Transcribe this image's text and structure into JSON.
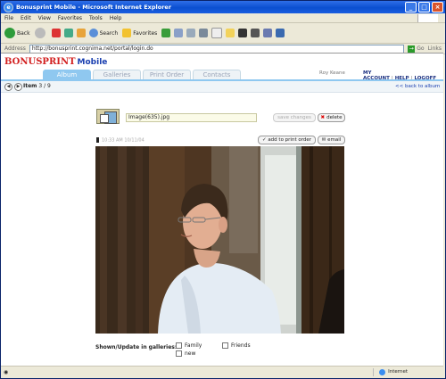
{
  "window": {
    "title": "Bonusprint Mobile - Microsoft Internet Explorer"
  },
  "menu": [
    "File",
    "Edit",
    "View",
    "Favorites",
    "Tools",
    "Help"
  ],
  "toolbar": {
    "back_label": "Back",
    "search_label": "Search",
    "favorites_label": "Favorites"
  },
  "address": {
    "label": "Address",
    "url": "http://bonusprint.cognima.net/portal/login.do",
    "go_label": "Go",
    "links_label": "Links"
  },
  "brand": {
    "name": "BONUSPRINT",
    "suffix": "Mobile"
  },
  "tabs": [
    "Album",
    "Galleries",
    "Print Order",
    "Contacts"
  ],
  "user": {
    "name": "Roy Keane"
  },
  "links": {
    "account": "MY ACCOUNT",
    "help": "HELP",
    "logoff": "LOGOFF"
  },
  "item_nav": {
    "prefix": "Item",
    "current": "3 / 9",
    "back": "<< back to album"
  },
  "photo": {
    "filename": "Image(635).jpg",
    "timestamp": "10:33 AM 10/11/04"
  },
  "buttons": {
    "save": "save changes",
    "delete": "delete",
    "add_print": "add to print order",
    "email": "email"
  },
  "galleries": {
    "label": "Shown/Update in galleries:",
    "options": [
      "Family",
      "Friends",
      "new"
    ]
  },
  "status": {
    "zone": "Internet"
  },
  "colors": {
    "brand_red": "#d21f1f",
    "tab_active": "#8fc8f0",
    "link_blue": "#1a2f80"
  }
}
